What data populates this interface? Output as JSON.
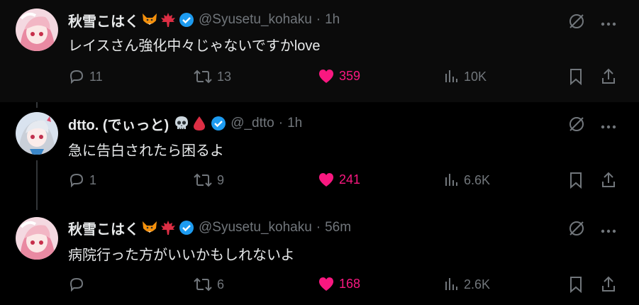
{
  "tweets": [
    {
      "name": "秋雪こはく",
      "emojis": [
        "fox-icon",
        "maple-leaf-icon"
      ],
      "handle": "@Syusetu_kohaku",
      "time": "1h",
      "text": "レイスさん強化中々じゃないですかlove",
      "replies": "11",
      "retweets": "13",
      "likes": "359",
      "views": "10K"
    },
    {
      "name": "dtto. (でぃっと)",
      "emojis": [
        "skull-icon",
        "blood-drop-icon"
      ],
      "handle": "@_dtto",
      "time": "1h",
      "text": "急に告白されたら困るよ",
      "replies": "1",
      "retweets": "9",
      "likes": "241",
      "views": "6.6K"
    },
    {
      "name": "秋雪こはく",
      "emojis": [
        "fox-icon",
        "maple-leaf-icon"
      ],
      "handle": "@Syusetu_kohaku",
      "time": "56m",
      "text": "病院行った方がいいかもしれないよ",
      "replies": "",
      "retweets": "6",
      "likes": "168",
      "views": "2.6K"
    }
  ],
  "separator": "·",
  "colors": {
    "like": "#f91880",
    "verified": "#1d9bf0",
    "muted": "#71767b"
  }
}
